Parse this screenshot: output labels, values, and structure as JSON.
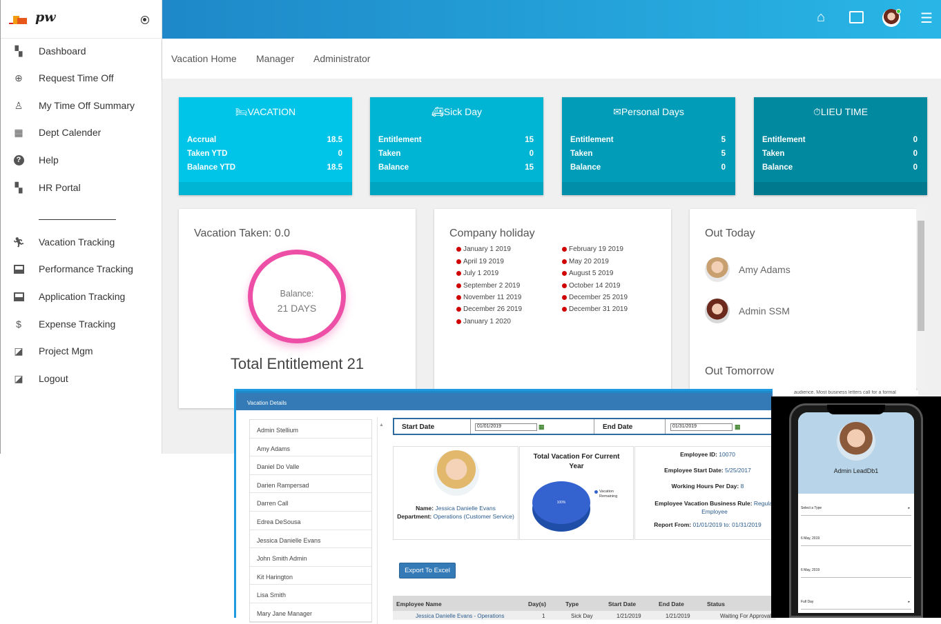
{
  "sidebar": {
    "logo_text": "pw",
    "items": [
      {
        "label": "Dashboard",
        "icon": "dashboard-icon"
      },
      {
        "label": "Request Time Off",
        "icon": "plus-circle-icon"
      },
      {
        "label": "My Time Off Summary",
        "icon": "person-icon"
      },
      {
        "label": "Dept Calender",
        "icon": "calendar-icon"
      },
      {
        "label": "Help",
        "icon": "help-icon"
      },
      {
        "label": "HR Portal",
        "icon": "dashboard-icon"
      },
      {
        "label": "Vacation Tracking",
        "icon": "runner-icon"
      },
      {
        "label": "Performance Tracking",
        "icon": "card-icon"
      },
      {
        "label": "Application Tracking",
        "icon": "card-icon"
      },
      {
        "label": "Expense Tracking",
        "icon": "dollar-icon"
      },
      {
        "label": "Project Mgm",
        "icon": "library-icon"
      },
      {
        "label": "Logout",
        "icon": "library-icon"
      }
    ],
    "divider": "________________"
  },
  "topbar": {
    "icons": [
      "home-icon",
      "fullscreen-icon",
      "user-avatar",
      "menu-collapse-icon"
    ]
  },
  "subnav": [
    "Vacation Home",
    "Manager",
    "Administrator"
  ],
  "cards": [
    {
      "title": "VACATION",
      "icon": "bed-icon",
      "color": "#00c5e8",
      "rows": [
        [
          "Accrual",
          "18.5"
        ],
        [
          "Taken YTD",
          "0"
        ],
        [
          "Balance YTD",
          "18.5"
        ]
      ]
    },
    {
      "title": "Sick Day",
      "icon": "ambulance-icon",
      "color": "#00b5d3",
      "rows": [
        [
          "Entitlement",
          "15"
        ],
        [
          "Taken",
          "0"
        ],
        [
          "Balance",
          "15"
        ]
      ]
    },
    {
      "title": "Personal Days",
      "icon": "envelope-icon",
      "color": "#009cb8",
      "rows": [
        [
          "Entitlement",
          "5"
        ],
        [
          "Taken",
          "5"
        ],
        [
          "Balance",
          "0"
        ]
      ]
    },
    {
      "title": "LIEU TIME",
      "icon": "stopwatch-icon",
      "color": "#00899f",
      "rows": [
        [
          "Entitlement",
          "0"
        ],
        [
          "Taken",
          "0"
        ],
        [
          "Balance",
          "0"
        ]
      ]
    }
  ],
  "vacation_panel": {
    "title": "Vacation Taken:  0.0",
    "balance_label": "Balance:",
    "balance_value": "21 DAYS",
    "total": "Total Entitlement 21"
  },
  "holiday_panel": {
    "title": "Company holiday",
    "col1": [
      "January 1 2019",
      "April 19 2019",
      "July 1 2019",
      "September 2 2019",
      "November 11 2019",
      "December 26 2019",
      "January 1 2020"
    ],
    "col2": [
      "February 19 2019",
      "May 20 2019",
      "August 5 2019",
      "October 14 2019",
      "December 25 2019",
      "December 31 2019"
    ]
  },
  "out_panel": {
    "title": "Out Today",
    "people": [
      "Amy Adams",
      "Admin SSM"
    ],
    "tomorrow": "Out Tomorrow"
  },
  "overlay": {
    "title": "Vacation Details",
    "employees": [
      "Admin Stellium",
      "Amy Adams",
      "Daniel Do Valle",
      "Darien Rampersad",
      "Darren Call",
      "Edrea DeSousa",
      "Jessica Danielle Evans",
      "John Smith Admin",
      "Kit Harington",
      "Lisa Smith",
      "Mary Jane Manager"
    ],
    "start_label": "Start Date",
    "start_value": "01/01/2019",
    "end_label": "End Date",
    "end_value": "01/31/2019",
    "name_label": "Name:",
    "name_value": "Jessica Danielle Evans",
    "dept_label": "Department:",
    "dept_value": "Operations (Customer Service)",
    "pie_title": "Total Vacation For Current Year",
    "pie_pct": "100%",
    "pie_legend": "Vacation Remaining",
    "emp_id_label": "Employee ID:",
    "emp_id": "10070",
    "start_date_label": "Employee Start Date:",
    "start_date": "5/25/2017",
    "hours_label": "Working Hours Per Day:",
    "hours": "8",
    "rule_label": "Employee Vacation Business Rule:",
    "rule": "Regular Employee",
    "report_label": "Report From:",
    "report": "01/01/2019 to: 01/31/2019",
    "export_label": "Export To Excel",
    "columns": [
      "Employee Name",
      "Day(s)",
      "Type",
      "Start Date",
      "End Date",
      "Status"
    ],
    "row": [
      "Jessica Danielle Evans - Operations",
      "1",
      "Sick Day",
      "1/21/2019",
      "1/21/2019",
      "Waiting For Approval"
    ]
  },
  "phone": {
    "name": "Admin LeadDb1",
    "fields": [
      "Select a Type",
      "6 May, 2019",
      "6 May, 2019",
      "Full Day"
    ]
  },
  "snippet": "audience. Most business letters call for a formal"
}
